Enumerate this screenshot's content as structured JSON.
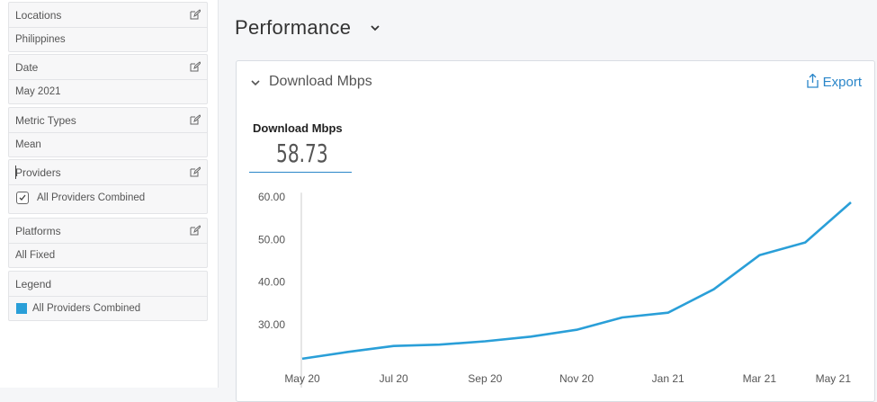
{
  "sidebar": {
    "filters": [
      {
        "title": "Locations",
        "value": "Philippines"
      },
      {
        "title": "Date",
        "value": "May 2021"
      },
      {
        "title": "Metric Types",
        "value": "Mean"
      },
      {
        "title": "Providers",
        "value": "All Providers Combined"
      },
      {
        "title": "Platforms",
        "value": "All Fixed"
      },
      {
        "title": "Legend",
        "value": "All Providers Combined"
      }
    ],
    "legend_color": "#2a9fd8"
  },
  "main": {
    "title": "Performance",
    "panel": {
      "title": "Download Mbps",
      "export_label": "Export",
      "metric_label": "Download Mbps",
      "metric_value": "58.73"
    }
  },
  "chart_data": {
    "type": "line",
    "x": [
      "May 20",
      "Jun 20",
      "Jul 20",
      "Aug 20",
      "Sep 20",
      "Oct 20",
      "Nov 20",
      "Dec 20",
      "Jan 21",
      "Feb 21",
      "Mar 21",
      "Apr 21",
      "May 21"
    ],
    "x_tick_labels": [
      "May 20",
      "Jul 20",
      "Sep 20",
      "Nov 20",
      "Jan 21",
      "Mar 21",
      "May 21"
    ],
    "series": [
      {
        "values": [
          22.0,
          23.6,
          25.0,
          25.3,
          26.1,
          27.2,
          28.8,
          31.7,
          32.8,
          38.3,
          46.3,
          49.3,
          58.73
        ]
      }
    ],
    "y_tick_labels": [
      "30.00",
      "40.00",
      "50.00",
      "60.00"
    ],
    "ylim": [
      20,
      62
    ],
    "grid": false,
    "color": "#2a9fd8"
  }
}
